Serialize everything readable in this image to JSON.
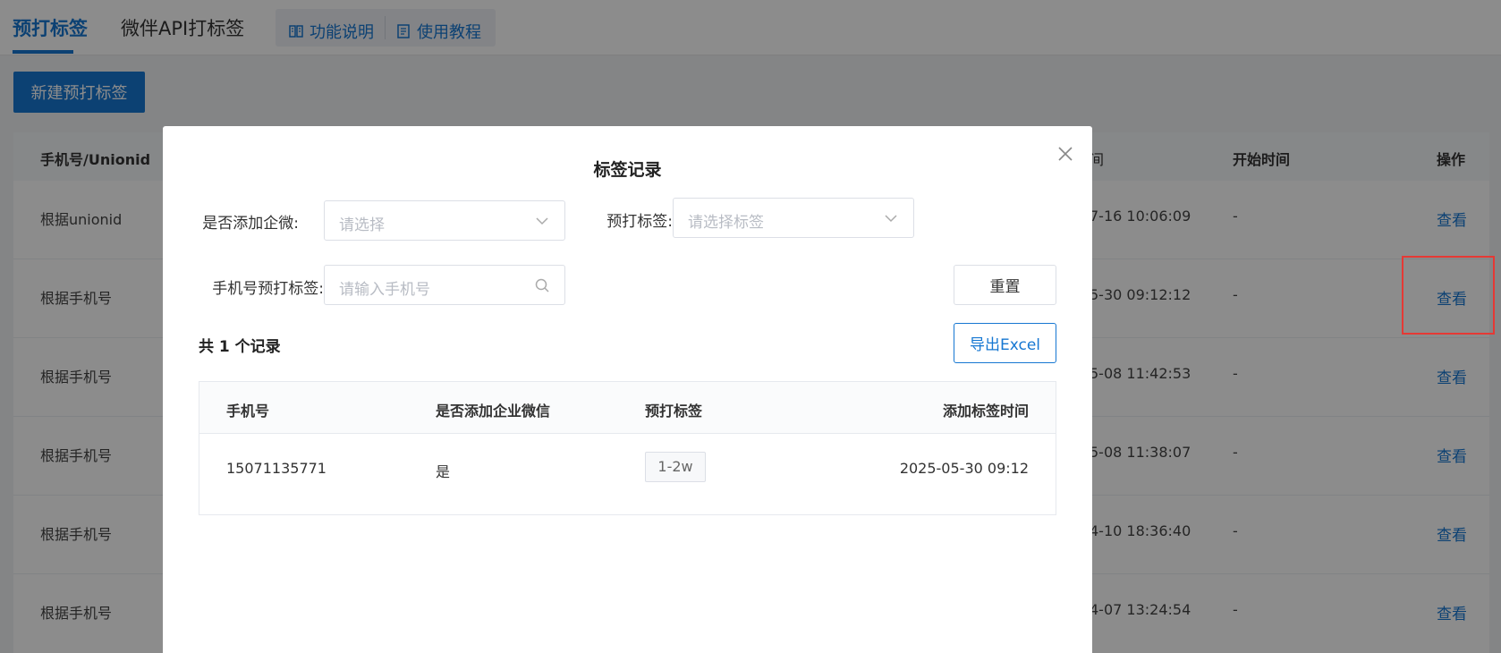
{
  "topbar": {
    "tabs": [
      {
        "label": "预打标签",
        "active": true
      },
      {
        "label": "微伴API打标签",
        "active": false
      }
    ],
    "help": [
      {
        "label": "功能说明",
        "icon": "book-icon"
      },
      {
        "label": "使用教程",
        "icon": "document-icon"
      }
    ]
  },
  "toolbar": {
    "new_label": "新建预打标签"
  },
  "bg_table": {
    "headers": {
      "col1": "手机号/Unionid",
      "col_time": "间",
      "col_start": "开始时间",
      "col_op": "操作"
    },
    "rows": [
      {
        "type": "根据unionid",
        "time": "7-16 10:06:09",
        "start": "-",
        "action": "查看"
      },
      {
        "type": "根据手机号",
        "time": "5-30 09:12:12",
        "start": "-",
        "action": "查看"
      },
      {
        "type": "根据手机号",
        "time": "5-08 11:42:53",
        "start": "-",
        "action": "查看"
      },
      {
        "type": "根据手机号",
        "time": "5-08 11:38:07",
        "start": "-",
        "action": "查看"
      },
      {
        "type": "根据手机号",
        "time": "4-10 18:36:40",
        "start": "-",
        "action": "查看"
      },
      {
        "type": "根据手机号",
        "time": "4-07 13:24:54",
        "start": "-",
        "action": "查看"
      }
    ]
  },
  "modal": {
    "title": "标签记录",
    "filters": {
      "added_label": "是否添加企微:",
      "added_placeholder": "请选择",
      "tag_label": "预打标签:",
      "tag_placeholder": "请选择标签",
      "phone_label": "手机号预打标签:",
      "phone_placeholder": "请输入手机号"
    },
    "reset_label": "重置",
    "export_label": "导出Excel",
    "count_text": "共 1 个记录",
    "table": {
      "headers": [
        "手机号",
        "是否添加企业微信",
        "预打标签",
        "添加标签时间"
      ],
      "rows": [
        {
          "phone": "15071135771",
          "added": "是",
          "tag": "1-2w",
          "time": "2025-05-30 09:12"
        }
      ]
    }
  },
  "colors": {
    "primary": "#1677d2",
    "highlight": "#e53935"
  }
}
